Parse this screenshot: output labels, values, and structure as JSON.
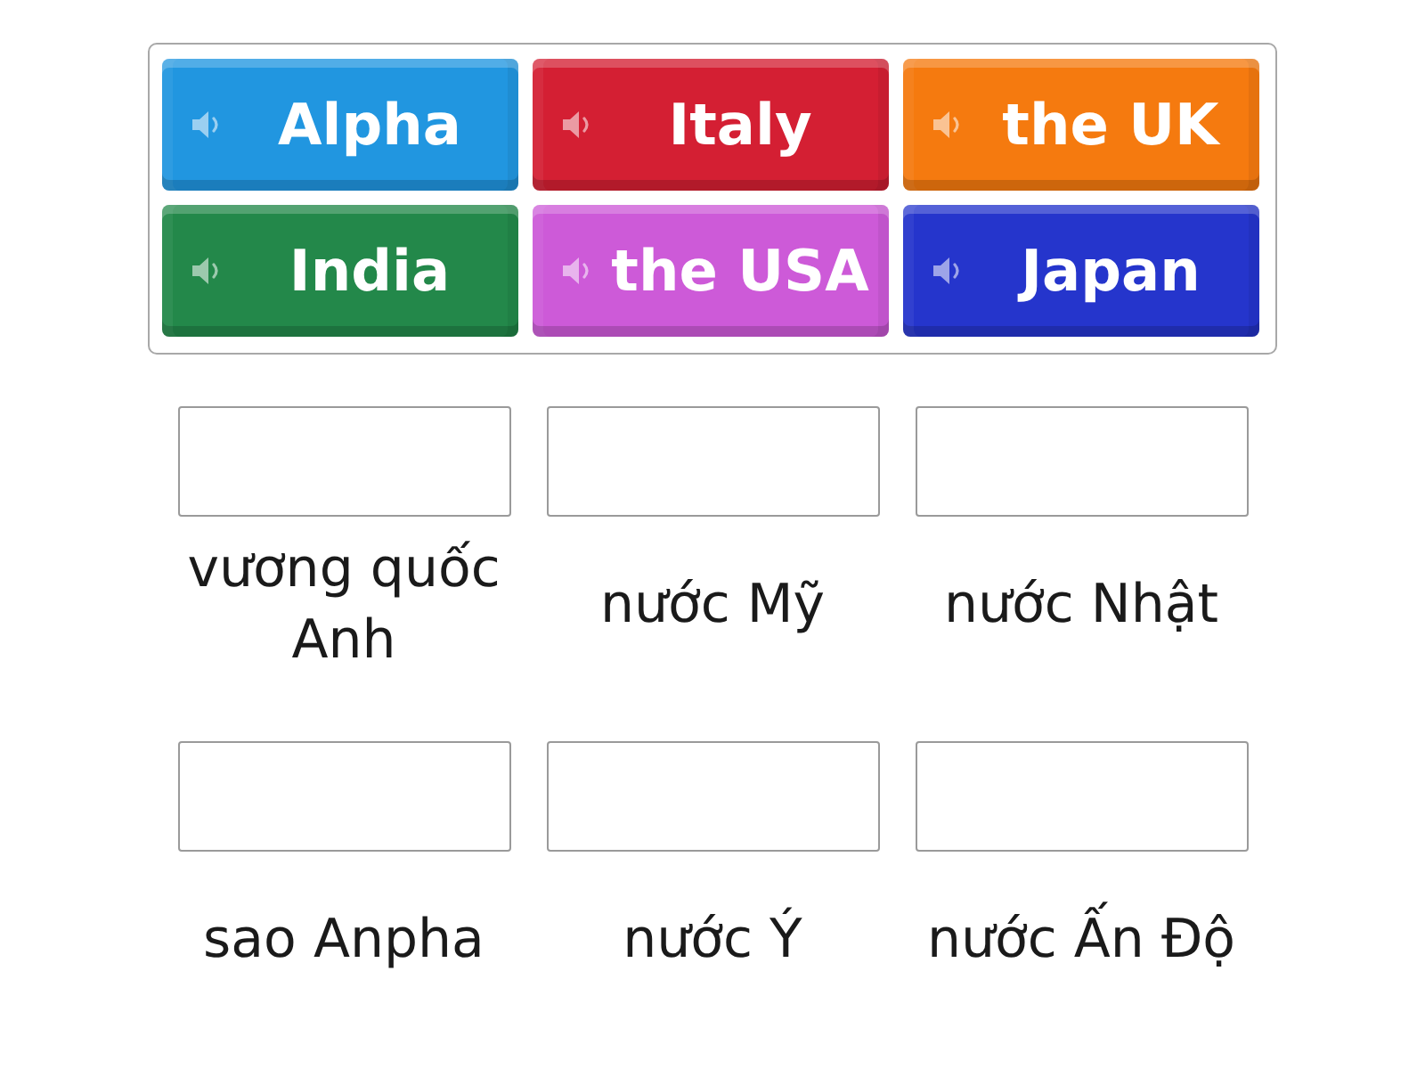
{
  "tiles": [
    {
      "label": "Alpha",
      "color": "#2196e0"
    },
    {
      "label": "Italy",
      "color": "#d41f33"
    },
    {
      "label": "the UK",
      "color": "#f57a0f"
    },
    {
      "label": "India",
      "color": "#23884a"
    },
    {
      "label": "the USA",
      "color": "#cd5ad8"
    },
    {
      "label": "Japan",
      "color": "#2535cc"
    }
  ],
  "targets": [
    {
      "label": "vương quốc Anh"
    },
    {
      "label": "nước Mỹ"
    },
    {
      "label": "nước Nhật"
    },
    {
      "label": "sao Anpha"
    },
    {
      "label": "nước Ý"
    },
    {
      "label": "nước Ấn Độ"
    }
  ]
}
